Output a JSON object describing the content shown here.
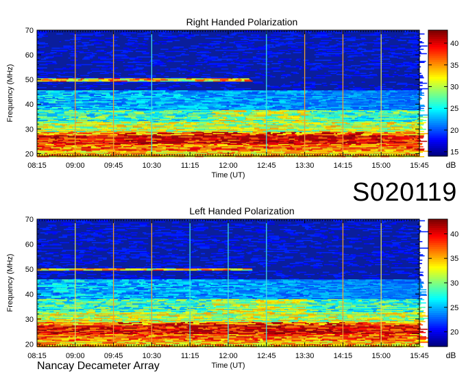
{
  "observation_code": "S020119",
  "instrument_label": "Nancay Decameter Array",
  "chart_data": [
    {
      "type": "heatmap",
      "title": "Right Handed Polarization",
      "xlabel": "Time (UT)",
      "ylabel": "Frequency (MHz)",
      "x_ticks": [
        "08:15",
        "09:00",
        "09:45",
        "10:30",
        "11:15",
        "12:00",
        "12:45",
        "13:30",
        "14:15",
        "15:00",
        "15:45"
      ],
      "y_ticks": [
        20,
        30,
        40,
        50,
        60,
        70
      ],
      "ylim": [
        19,
        70
      ],
      "colorbar": {
        "label": "dB",
        "ticks": [
          15,
          20,
          25,
          30,
          35,
          40
        ],
        "range": [
          14,
          43
        ]
      },
      "marker_times": [
        {
          "time": "09:00",
          "color": "#f0a030"
        },
        {
          "time": "09:45",
          "color": "#f0a030"
        },
        {
          "time": "10:30",
          "color": "#40e0e0"
        },
        {
          "time": "12:45",
          "color": "#40e0e0"
        },
        {
          "time": "13:30",
          "color": "#f0a030"
        },
        {
          "time": "14:15",
          "color": "#f0a030"
        },
        {
          "time": "15:00",
          "color": "#e0e060"
        }
      ]
    },
    {
      "type": "heatmap",
      "title": "Left Handed Polarization",
      "xlabel": "Time (UT)",
      "ylabel": "Frequency (MHz)",
      "x_ticks": [
        "08:15",
        "09:00",
        "09:45",
        "10:30",
        "11:15",
        "12:00",
        "12:45",
        "13:30",
        "14:15",
        "15:00",
        "15:45"
      ],
      "y_ticks": [
        20,
        30,
        40,
        50,
        60,
        70
      ],
      "ylim": [
        19,
        70
      ],
      "colorbar": {
        "label": "dB",
        "ticks": [
          20,
          25,
          30,
          35,
          40
        ],
        "range": [
          17,
          43
        ]
      },
      "marker_times": [
        {
          "time": "09:00",
          "color": "#e0e060"
        },
        {
          "time": "09:45",
          "color": "#f0a030"
        },
        {
          "time": "10:30",
          "color": "#f0a030"
        },
        {
          "time": "11:15",
          "color": "#40e0e0"
        },
        {
          "time": "12:00",
          "color": "#40e0e0"
        },
        {
          "time": "12:45",
          "color": "#40e0e0"
        },
        {
          "time": "14:15",
          "color": "#f0a030"
        },
        {
          "time": "15:00",
          "color": "#e0e060"
        }
      ]
    }
  ]
}
